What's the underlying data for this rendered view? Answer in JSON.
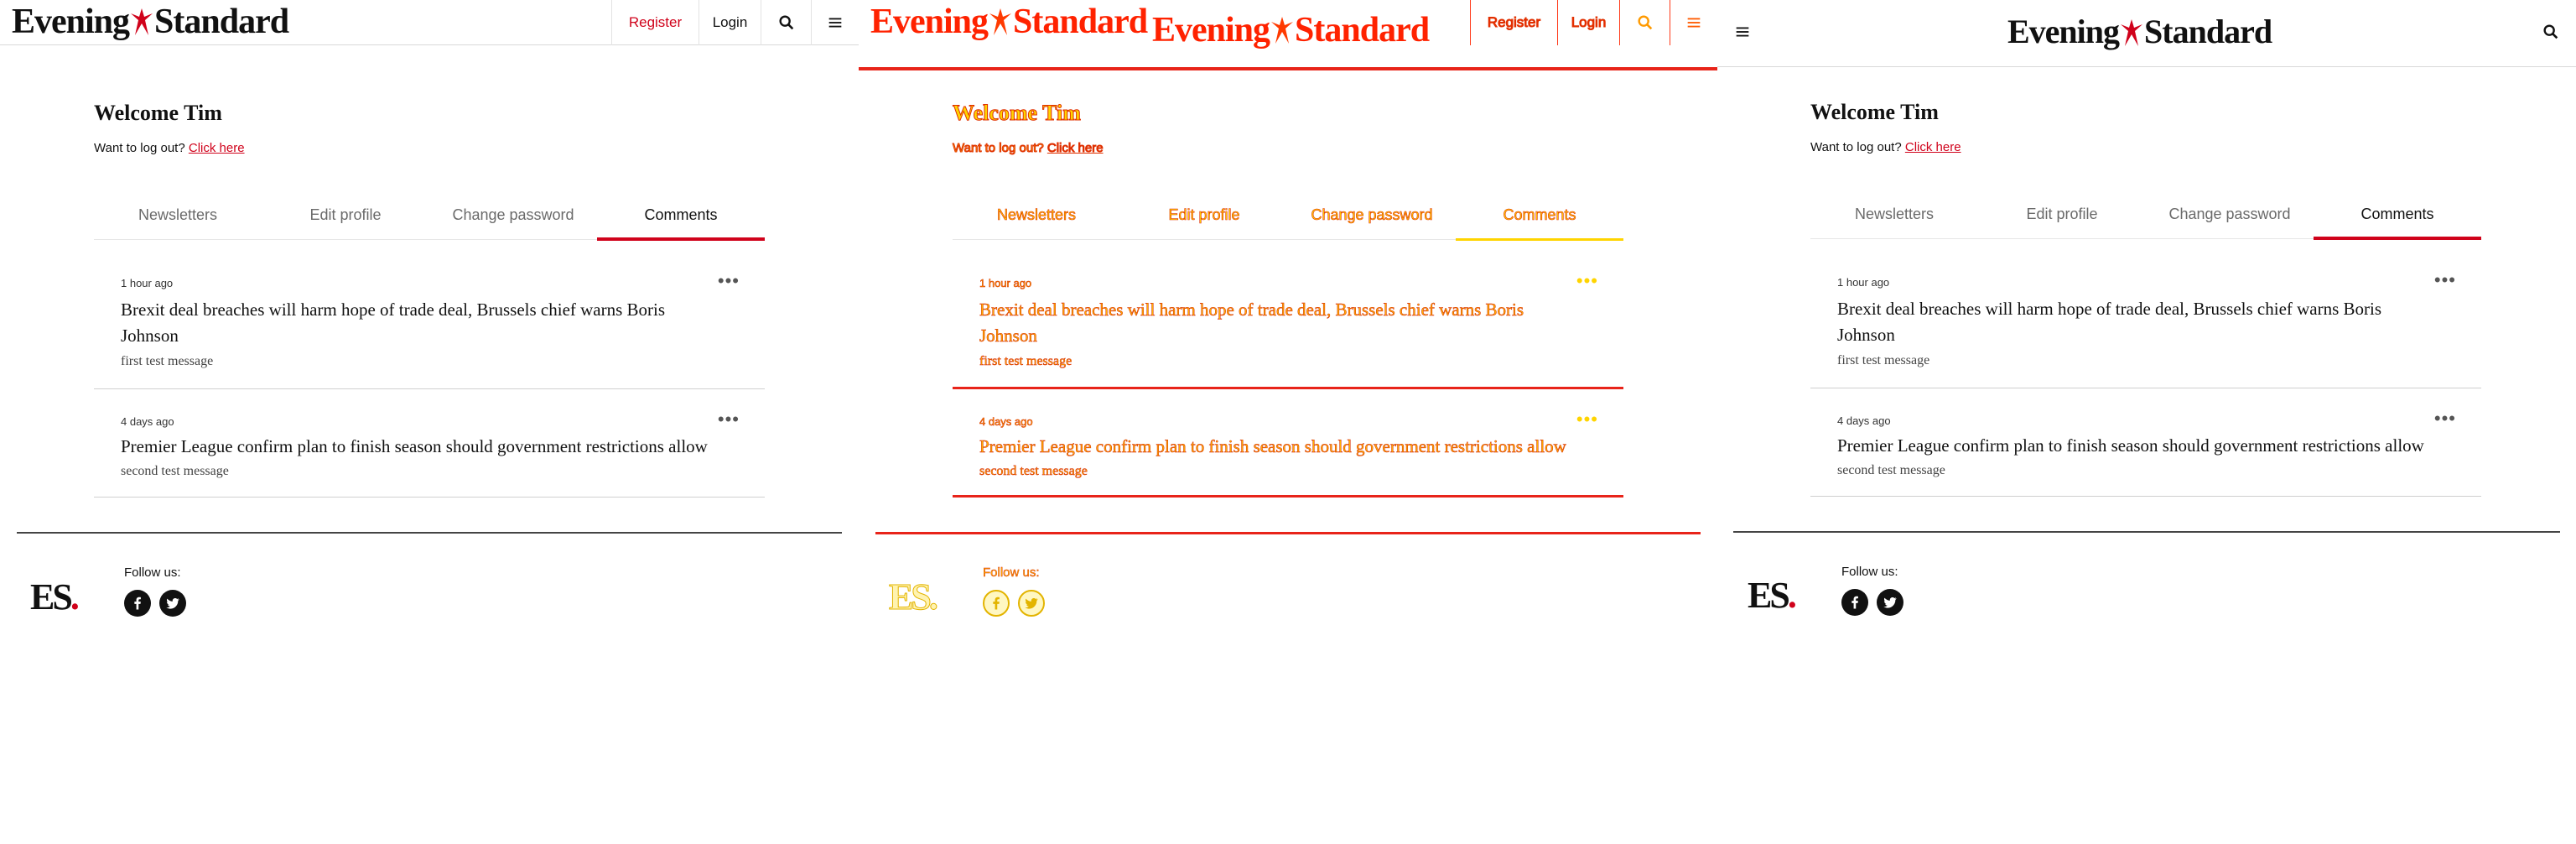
{
  "brand": {
    "logo_word1": "Evening",
    "logo_word2": "Standard",
    "footer_logo": "ES",
    "footer_logo_dot": ".",
    "accent_color": "#d0021b"
  },
  "header": {
    "register_label": "Register",
    "login_label": "Login",
    "search_icon": "search-icon",
    "menu_icon": "menu-icon"
  },
  "account": {
    "welcome": "Welcome Tim",
    "logout_prompt": "Want to log out?",
    "logout_link": "Click here"
  },
  "tabs": [
    {
      "label": "Newsletters",
      "active": false
    },
    {
      "label": "Edit profile",
      "active": false
    },
    {
      "label": "Change password",
      "active": false
    },
    {
      "label": "Comments",
      "active": true
    }
  ],
  "comments": [
    {
      "time": "1 hour ago",
      "title": "Brexit deal breaches will harm hope of trade deal, Brussels chief warns Boris Johnson",
      "message": "first test message",
      "more": "•••"
    },
    {
      "time": "4 days ago",
      "title": "Premier League confirm plan to finish season should government restrictions allow",
      "message": "second test message",
      "more": "•••"
    }
  ],
  "footer": {
    "follow_label": "Follow us:",
    "social": [
      "facebook-icon",
      "twitter-icon"
    ]
  }
}
